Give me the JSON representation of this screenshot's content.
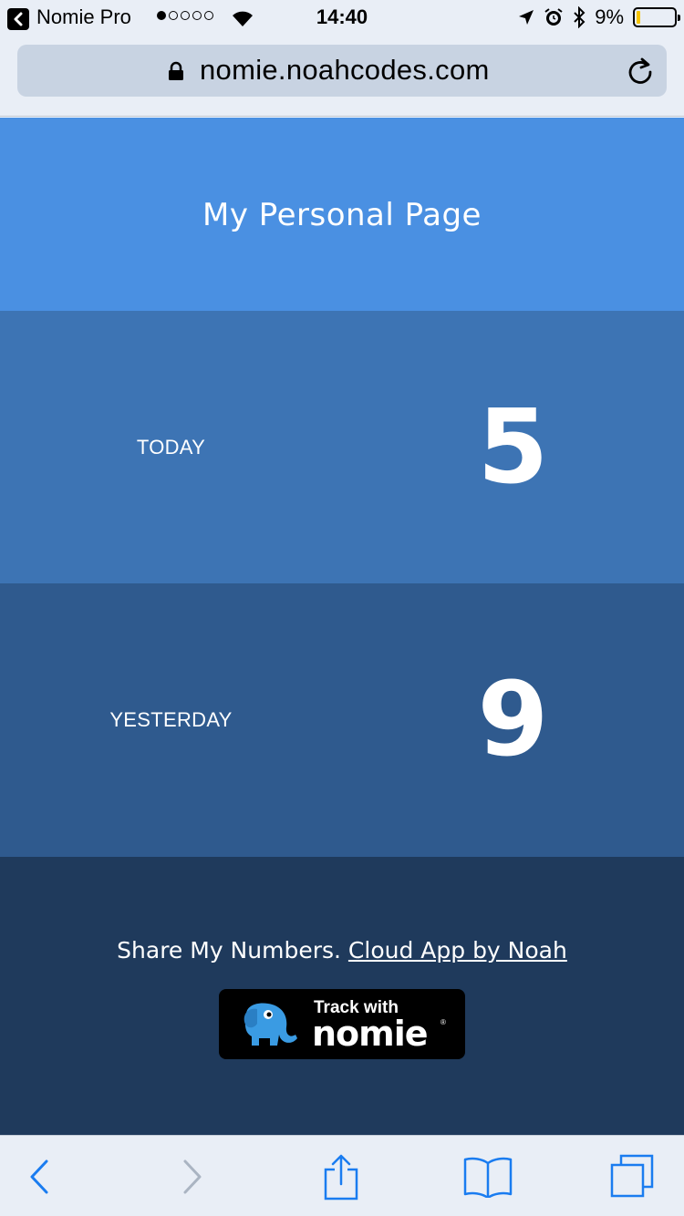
{
  "status_bar": {
    "app_name": "Nomie Pro",
    "time": "14:40",
    "battery_percent": "9%",
    "battery_level": 0.09,
    "signal_bars": 1
  },
  "address_bar": {
    "url": "nomie.noahcodes.com"
  },
  "page": {
    "title": "My Personal Page",
    "stats": [
      {
        "label": "TODAY",
        "value": "5"
      },
      {
        "label": "YESTERDAY",
        "value": "9"
      }
    ],
    "footer": {
      "share_text": "Share My Numbers.",
      "link_text": "Cloud App by Noah",
      "badge_top": "Track with",
      "badge_brand": "nomie",
      "badge_reg": "®"
    }
  },
  "colors": {
    "hero": "#4a90e2",
    "today_row": "#3d74b4",
    "yesterday_row": "#2f5a8e",
    "footer": "#1f3a5c",
    "toolbar_accent": "#1a7cf0"
  },
  "icons": [
    "back-to-app-icon",
    "wifi-icon",
    "location-icon",
    "alarm-icon",
    "bluetooth-icon",
    "lock-icon",
    "reload-icon",
    "back-icon",
    "forward-icon",
    "share-icon",
    "bookmarks-icon",
    "tabs-icon",
    "elephant-icon"
  ]
}
